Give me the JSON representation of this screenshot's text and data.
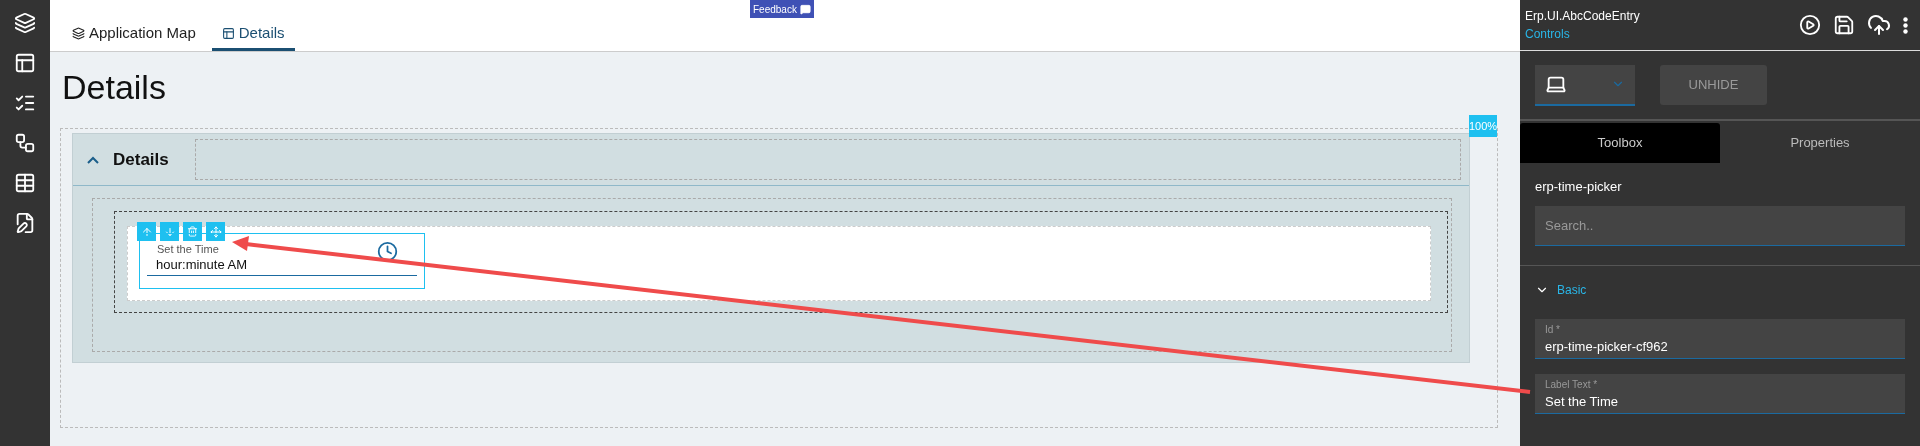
{
  "tabs": [
    {
      "label": "Application Map",
      "selected": false
    },
    {
      "label": "Details",
      "selected": true
    }
  ],
  "feedback": "Feedback",
  "page_title": "Details",
  "zoom_badge": "100%",
  "section": {
    "title": "Details",
    "expanded": true,
    "time_picker": {
      "label": "Set the Time",
      "value": "hour:minute AM"
    }
  },
  "panel": {
    "title": "Erp.UI.AbcCodeEntry",
    "subtitle": "Controls",
    "unhide": "UNHIDE",
    "tabs": [
      {
        "label": "Toolbox",
        "selected": true
      },
      {
        "label": "Properties",
        "selected": false
      }
    ],
    "component": "erp-time-picker",
    "search": {
      "placeholder": "Search.."
    },
    "group": {
      "title": "Basic",
      "expanded": true,
      "fields": [
        {
          "label": "Id *",
          "value": "erp-time-picker-cf962"
        },
        {
          "label": "Label Text *",
          "value": "Set the Time"
        }
      ]
    }
  }
}
